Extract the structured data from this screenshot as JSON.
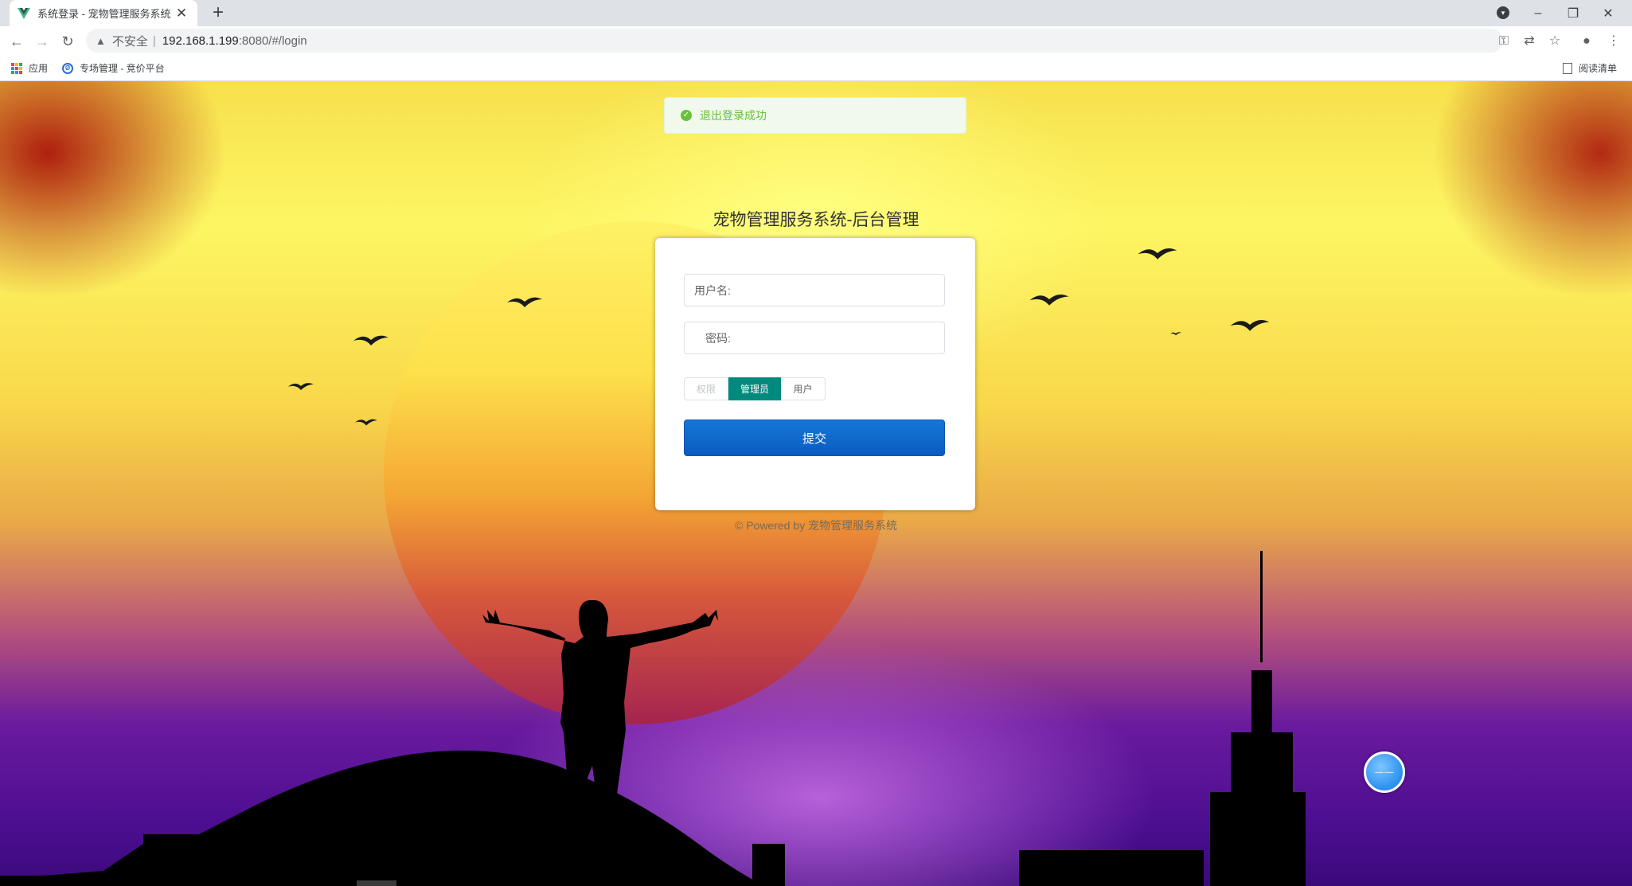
{
  "browser": {
    "tab_title": "系统登录 - 宠物管理服务系统",
    "tab_close": "✕",
    "new_tab": "+",
    "security_label": "不安全",
    "url_host": "192.168.1.199",
    "url_path": ":8080/#/login",
    "bookmarks": [
      {
        "label": "应用"
      },
      {
        "label": "专场管理 - 竞价平台"
      }
    ],
    "reading_list": "阅读清单"
  },
  "toast": {
    "message": "退出登录成功"
  },
  "page": {
    "title": "宠物管理服务系统-后台管理",
    "username_label": "用户名:",
    "password_label": "密码:",
    "role_options": [
      {
        "label": "权限",
        "state": "disabled"
      },
      {
        "label": "管理员",
        "state": "selected"
      },
      {
        "label": "用户",
        "state": "normal"
      }
    ],
    "submit_label": "提交",
    "powered_prefix": "© Powered by ",
    "powered_name": "宠物管理服务系统"
  },
  "colors": {
    "accent": "#008a7e",
    "submit": "#0a5bbf",
    "success": "#67c23a"
  }
}
